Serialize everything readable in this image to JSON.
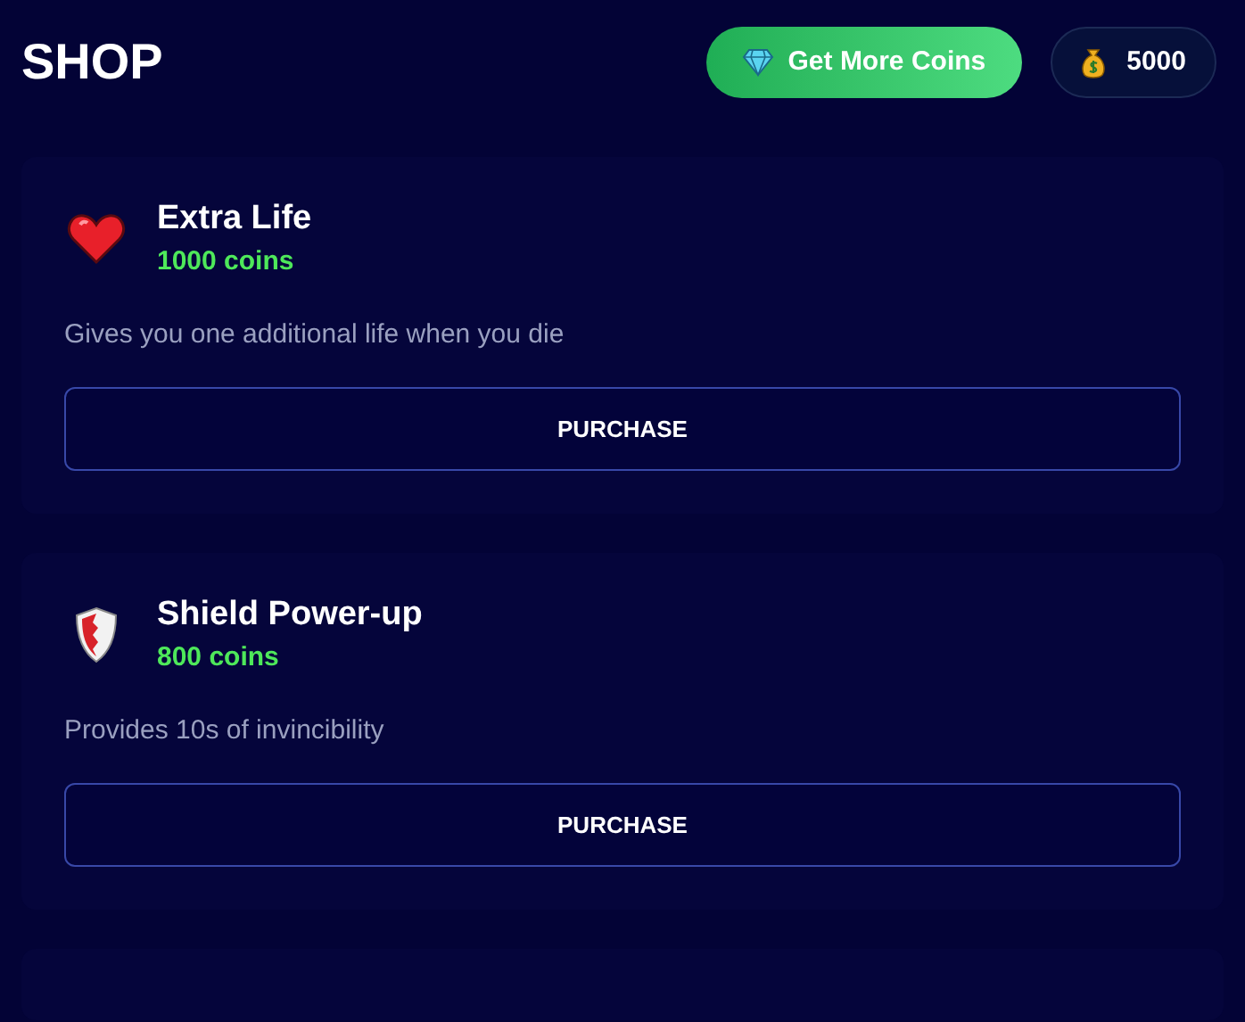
{
  "header": {
    "title": "SHOP",
    "get_coins_button": "Get More Coins",
    "balance": "5000"
  },
  "items": [
    {
      "kind": "heart",
      "name": "Extra Life",
      "price": "1000 coins",
      "description": "Gives you one additional life when you die",
      "button": "PURCHASE"
    },
    {
      "kind": "shield",
      "name": "Shield Power-up",
      "price": "800 coins",
      "description": "Provides 10s of invincibility",
      "button": "PURCHASE"
    }
  ]
}
